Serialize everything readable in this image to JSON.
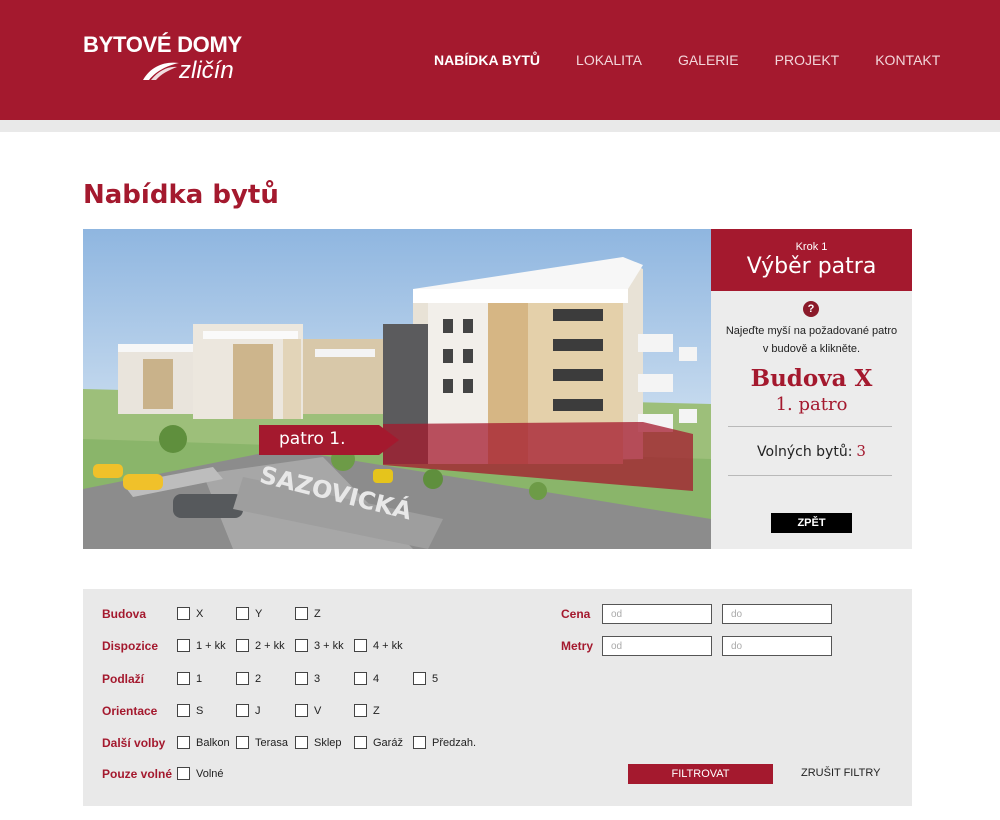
{
  "header": {
    "logo_top": "BYTOVÉ DOMY",
    "logo_bottom": "zličín",
    "nav": [
      {
        "label": "NABÍDKA BYTŮ",
        "active": true
      },
      {
        "label": "LOKALITA",
        "active": false
      },
      {
        "label": "GALERIE",
        "active": false
      },
      {
        "label": "PROJEKT",
        "active": false
      },
      {
        "label": "KONTAKT",
        "active": false
      }
    ]
  },
  "page": {
    "title": "Nabídka bytů"
  },
  "visual": {
    "floor_tag": "patro 1.",
    "street_name": "SAZOVICKÁ"
  },
  "panel": {
    "step": "Krok 1",
    "title": "Výběr patra",
    "help_icon": "?",
    "hint": "Najeďte myší na požadované patro v budově a klikněte.",
    "building": "Budova X",
    "floor": "1. patro",
    "free_label": "Volných bytů:",
    "free_count": "3",
    "back_label": "ZPĚT"
  },
  "filter": {
    "rows": [
      {
        "label": "Budova",
        "options": [
          "X",
          "Y",
          "Z"
        ]
      },
      {
        "label": "Dispozice",
        "options": [
          "1 + kk",
          "2 + kk",
          "3 + kk",
          "4 + kk"
        ]
      },
      {
        "label": "Podlaží",
        "options": [
          "1",
          "2",
          "3",
          "4",
          "5"
        ]
      },
      {
        "label": "Orientace",
        "options": [
          "S",
          "J",
          "V",
          "Z"
        ]
      },
      {
        "label": "Další volby",
        "options": [
          "Balkon",
          "Terasa",
          "Sklep",
          "Garáž",
          "Předzah."
        ]
      },
      {
        "label": "Pouze volné",
        "options": [
          "Volné"
        ]
      }
    ],
    "cena": {
      "label": "Cena",
      "from_placeholder": "od",
      "to_placeholder": "do"
    },
    "metry": {
      "label": "Metry",
      "from_placeholder": "od",
      "to_placeholder": "do"
    },
    "submit_label": "FILTROVAT",
    "clear_label": "ZRUŠIT FILTRY"
  },
  "colors": {
    "brand": "#a4192e",
    "panel_bg": "#ececec",
    "filter_bg": "#e9e9e9"
  }
}
